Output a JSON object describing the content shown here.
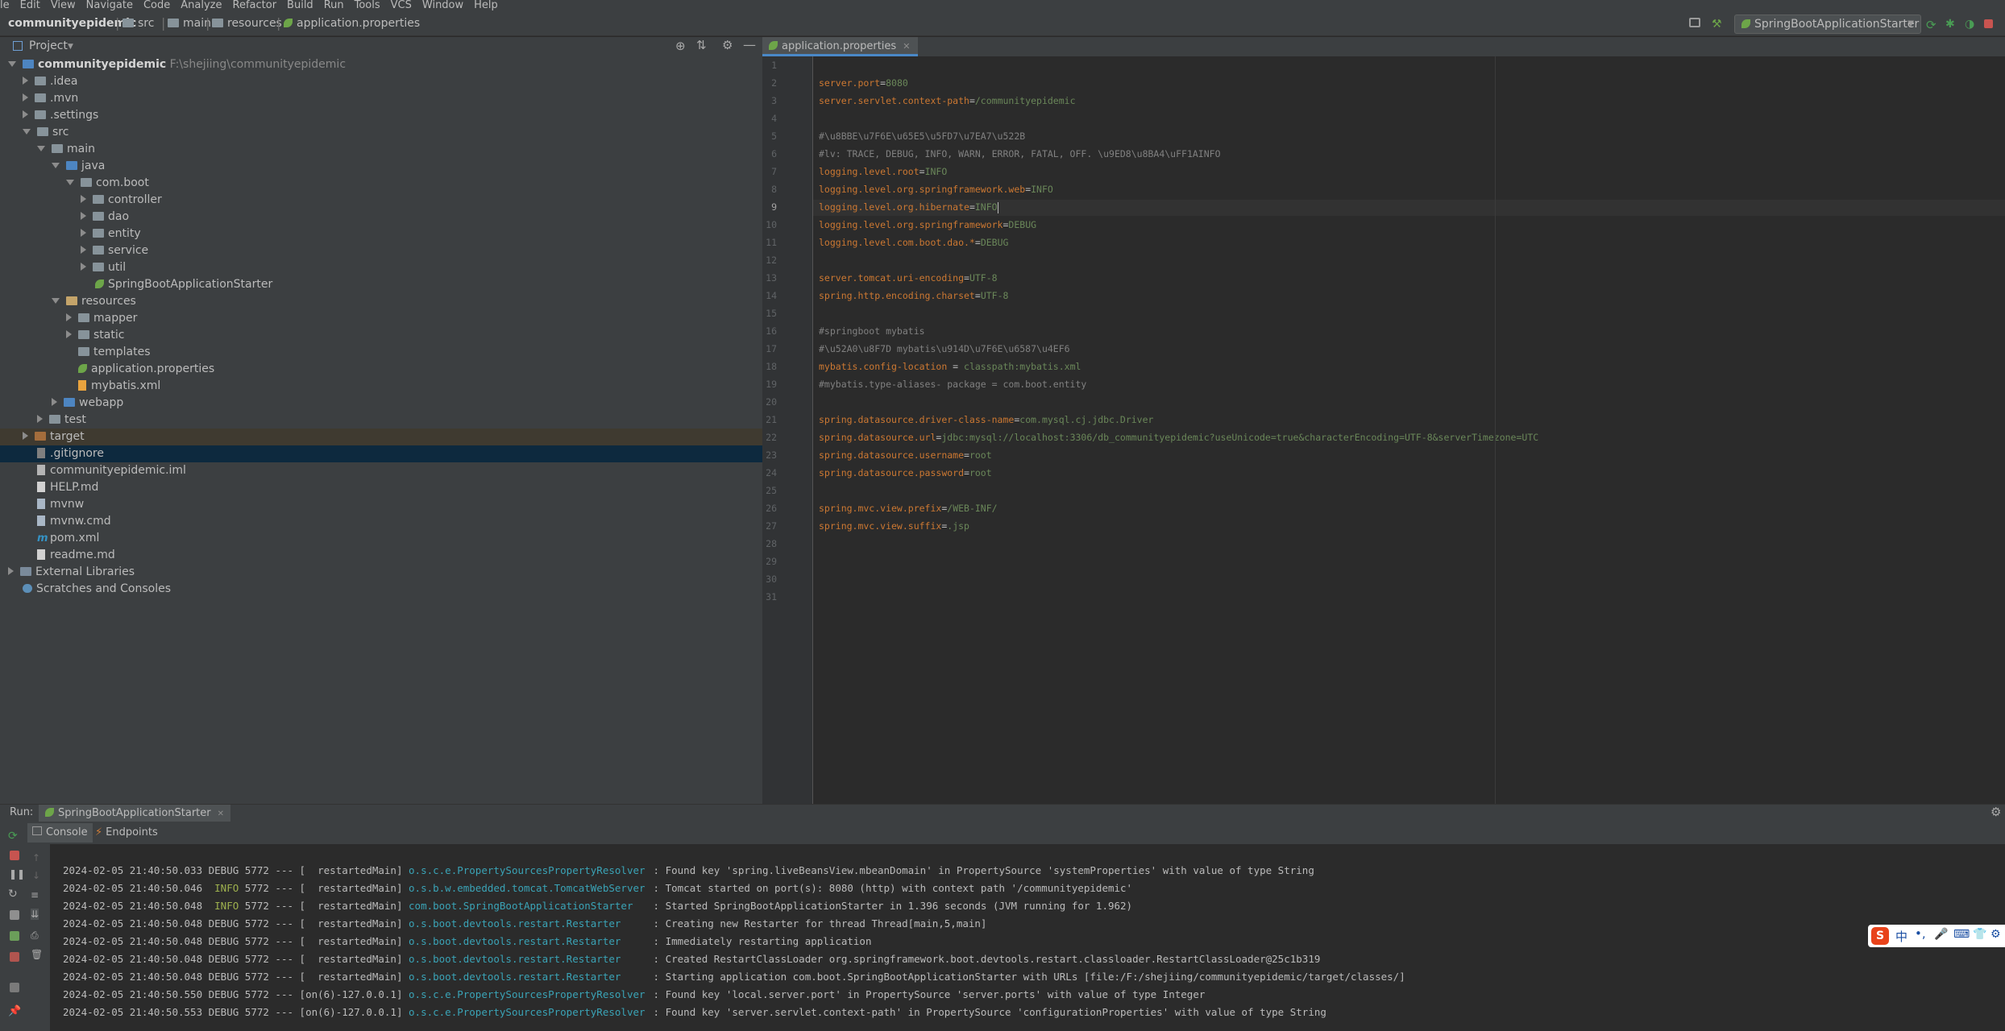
{
  "menu": [
    "le",
    "Edit",
    "View",
    "Navigate",
    "Code",
    "Analyze",
    "Refactor",
    "Build",
    "Run",
    "Tools",
    "VCS",
    "Window",
    "Help"
  ],
  "breadcrumbs": [
    "communityepidemic",
    "src",
    "main",
    "resources",
    "application.properties"
  ],
  "run_config": {
    "label": "SpringBootApplicationStarter"
  },
  "project_panel": {
    "title": "Project",
    "tree": [
      {
        "label": "communityepidemic",
        "path": "F:\\shejiing\\communityepidemic"
      },
      {
        "label": ".idea"
      },
      {
        "label": ".mvn"
      },
      {
        "label": ".settings"
      },
      {
        "label": "src"
      },
      {
        "label": "main"
      },
      {
        "label": "java"
      },
      {
        "label": "com.boot"
      },
      {
        "label": "controller"
      },
      {
        "label": "dao"
      },
      {
        "label": "entity"
      },
      {
        "label": "service"
      },
      {
        "label": "util"
      },
      {
        "label": "SpringBootApplicationStarter"
      },
      {
        "label": "resources"
      },
      {
        "label": "mapper"
      },
      {
        "label": "static"
      },
      {
        "label": "templates"
      },
      {
        "label": "application.properties"
      },
      {
        "label": "mybatis.xml"
      },
      {
        "label": "webapp"
      },
      {
        "label": "test"
      },
      {
        "label": "target"
      },
      {
        "label": ".gitignore"
      },
      {
        "label": "communityepidemic.iml"
      },
      {
        "label": "HELP.md"
      },
      {
        "label": "mvnw"
      },
      {
        "label": "mvnw.cmd"
      },
      {
        "label": "pom.xml"
      },
      {
        "label": "readme.md"
      },
      {
        "label": "External Libraries"
      },
      {
        "label": "Scratches and Consoles"
      }
    ]
  },
  "editor": {
    "tab": "application.properties",
    "line_numbers": [
      "1",
      "2",
      "3",
      "4",
      "5",
      "6",
      "7",
      "8",
      "9",
      "10",
      "11",
      "12",
      "13",
      "14",
      "15",
      "16",
      "17",
      "18",
      "19",
      "20",
      "21",
      "22",
      "23",
      "24",
      "25",
      "26",
      "27",
      "28",
      "29",
      "30",
      "31"
    ],
    "lines": [
      {
        "n": 2,
        "key": "server.port",
        "val": "8080"
      },
      {
        "n": 3,
        "key": "server.servlet.context-path",
        "val": "/communityepidemic"
      },
      {
        "n": 5,
        "comment": "#\\u8BBE\\u7F6E\\u65E5\\u5FD7\\u7EA7\\u522B"
      },
      {
        "n": 6,
        "comment": "#lv: TRACE, DEBUG, INFO, WARN, ERROR, FATAL, OFF. \\u9ED8\\u8BA4\\uFF1AINFO"
      },
      {
        "n": 7,
        "key": "logging.level.root",
        "val": "INFO"
      },
      {
        "n": 8,
        "key": "logging.level.org.springframework.web",
        "val": "INFO"
      },
      {
        "n": 9,
        "key": "logging.level.org.hibernate",
        "val": "INFO"
      },
      {
        "n": 10,
        "key": "logging.level.org.springframework",
        "val": "DEBUG"
      },
      {
        "n": 11,
        "key": "logging.level.com.boot.dao.*",
        "val": "DEBUG"
      },
      {
        "n": 13,
        "key": "server.tomcat.uri-encoding",
        "val": "UTF-8"
      },
      {
        "n": 14,
        "key": "spring.http.encoding.charset",
        "val": "UTF-8"
      },
      {
        "n": 16,
        "comment": "#springboot mybatis"
      },
      {
        "n": 17,
        "comment": "#\\u52A0\\u8F7D mybatis\\u914D\\u7F6E\\u6587\\u4EF6"
      },
      {
        "n": 18,
        "key": "mybatis.config-location ",
        "val": " classpath:mybatis.xml"
      },
      {
        "n": 19,
        "comment": "#mybatis.type-aliases- package = com.boot.entity"
      },
      {
        "n": 21,
        "key": "spring.datasource.driver-class-name",
        "val": "com.mysql.cj.jdbc.Driver"
      },
      {
        "n": 22,
        "key": "spring.datasource.url",
        "val": "jdbc:mysql://localhost:3306/db_communityepidemic?useUnicode=true&characterEncoding=UTF-8&serverTimezone=UTC"
      },
      {
        "n": 23,
        "key": "spring.datasource.username",
        "val": "root"
      },
      {
        "n": 24,
        "key": "spring.datasource.password",
        "val": "root"
      },
      {
        "n": 26,
        "key": "spring.mvc.view.prefix",
        "val": "/WEB-INF/"
      },
      {
        "n": 27,
        "key": "spring.mvc.view.suffix",
        "val": ".jsp"
      }
    ]
  },
  "run_panel": {
    "label": "Run:",
    "config_tab": "SpringBootApplicationStarter",
    "tabs": [
      "Console",
      "Endpoints"
    ],
    "log": [
      {
        "ts": "2024-02-05 21:40:50.033",
        "level": "DEBUG",
        "pid": "5772",
        "thread": "[  restartedMain]",
        "logger": "o.s.c.e.PropertySourcesPropertyResolver",
        "msg": ": Found key 'spring.liveBeansView.mbeanDomain' in PropertySource 'systemProperties' with value of type String"
      },
      {
        "ts": "2024-02-05 21:40:50.046",
        "level": " INFO",
        "pid": "5772",
        "thread": "[  restartedMain]",
        "logger": "o.s.b.w.embedded.tomcat.TomcatWebServer",
        "msg": ": Tomcat started on port(s): 8080 (http) with context path '/communityepidemic'"
      },
      {
        "ts": "2024-02-05 21:40:50.048",
        "level": " INFO",
        "pid": "5772",
        "thread": "[  restartedMain]",
        "logger": "com.boot.SpringBootApplicationStarter",
        "msg": ": Started SpringBootApplicationStarter in 1.396 seconds (JVM running for 1.962)"
      },
      {
        "ts": "2024-02-05 21:40:50.048",
        "level": "DEBUG",
        "pid": "5772",
        "thread": "[  restartedMain]",
        "logger": "o.s.boot.devtools.restart.Restarter",
        "msg": ": Creating new Restarter for thread Thread[main,5,main]"
      },
      {
        "ts": "2024-02-05 21:40:50.048",
        "level": "DEBUG",
        "pid": "5772",
        "thread": "[  restartedMain]",
        "logger": "o.s.boot.devtools.restart.Restarter",
        "msg": ": Immediately restarting application"
      },
      {
        "ts": "2024-02-05 21:40:50.048",
        "level": "DEBUG",
        "pid": "5772",
        "thread": "[  restartedMain]",
        "logger": "o.s.boot.devtools.restart.Restarter",
        "msg": ": Created RestartClassLoader org.springframework.boot.devtools.restart.classloader.RestartClassLoader@25c1b319"
      },
      {
        "ts": "2024-02-05 21:40:50.048",
        "level": "DEBUG",
        "pid": "5772",
        "thread": "[  restartedMain]",
        "logger": "o.s.boot.devtools.restart.Restarter",
        "msg": ": Starting application com.boot.SpringBootApplicationStarter with URLs [file:/F:/shejiing/communityepidemic/target/classes/]"
      },
      {
        "ts": "2024-02-05 21:40:50.550",
        "level": "DEBUG",
        "pid": "5772",
        "thread": "[on(6)-127.0.0.1]",
        "logger": "o.s.c.e.PropertySourcesPropertyResolver",
        "msg": ": Found key 'local.server.port' in PropertySource 'server.ports' with value of type Integer"
      },
      {
        "ts": "2024-02-05 21:40:50.553",
        "level": "DEBUG",
        "pid": "5772",
        "thread": "[on(6)-127.0.0.1]",
        "logger": "o.s.c.e.PropertySourcesPropertyResolver",
        "msg": ": Found key 'server.servlet.context-path' in PropertySource 'configurationProperties' with value of type String"
      }
    ]
  },
  "ime": {
    "label": "中"
  }
}
